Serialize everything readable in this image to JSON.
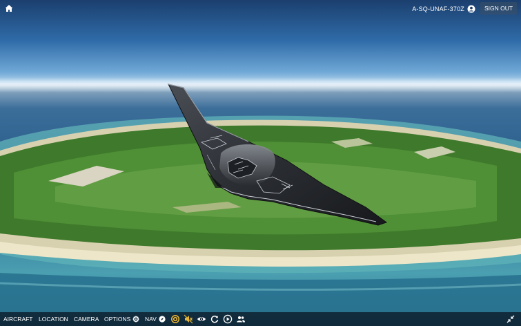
{
  "topbar": {
    "home_icon": "home-icon",
    "user_label": "A-SQ-UNAF-370Z",
    "user_icon": "account-icon",
    "signout_label": "SIGN OUT"
  },
  "bottombar": {
    "menus": {
      "aircraft": "AIRCRAFT",
      "location": "LOCATION",
      "camera": "CAMERA",
      "options": "OPTIONS",
      "nav": "NAV"
    },
    "tools": [
      "target-icon",
      "sound-muted-icon",
      "eye-icon",
      "refresh-icon",
      "play-icon",
      "people-icon"
    ],
    "right_icon": "collapse-icon"
  },
  "colors": {
    "accent": "#e3b43a",
    "bar_bg": "#0a1828"
  }
}
